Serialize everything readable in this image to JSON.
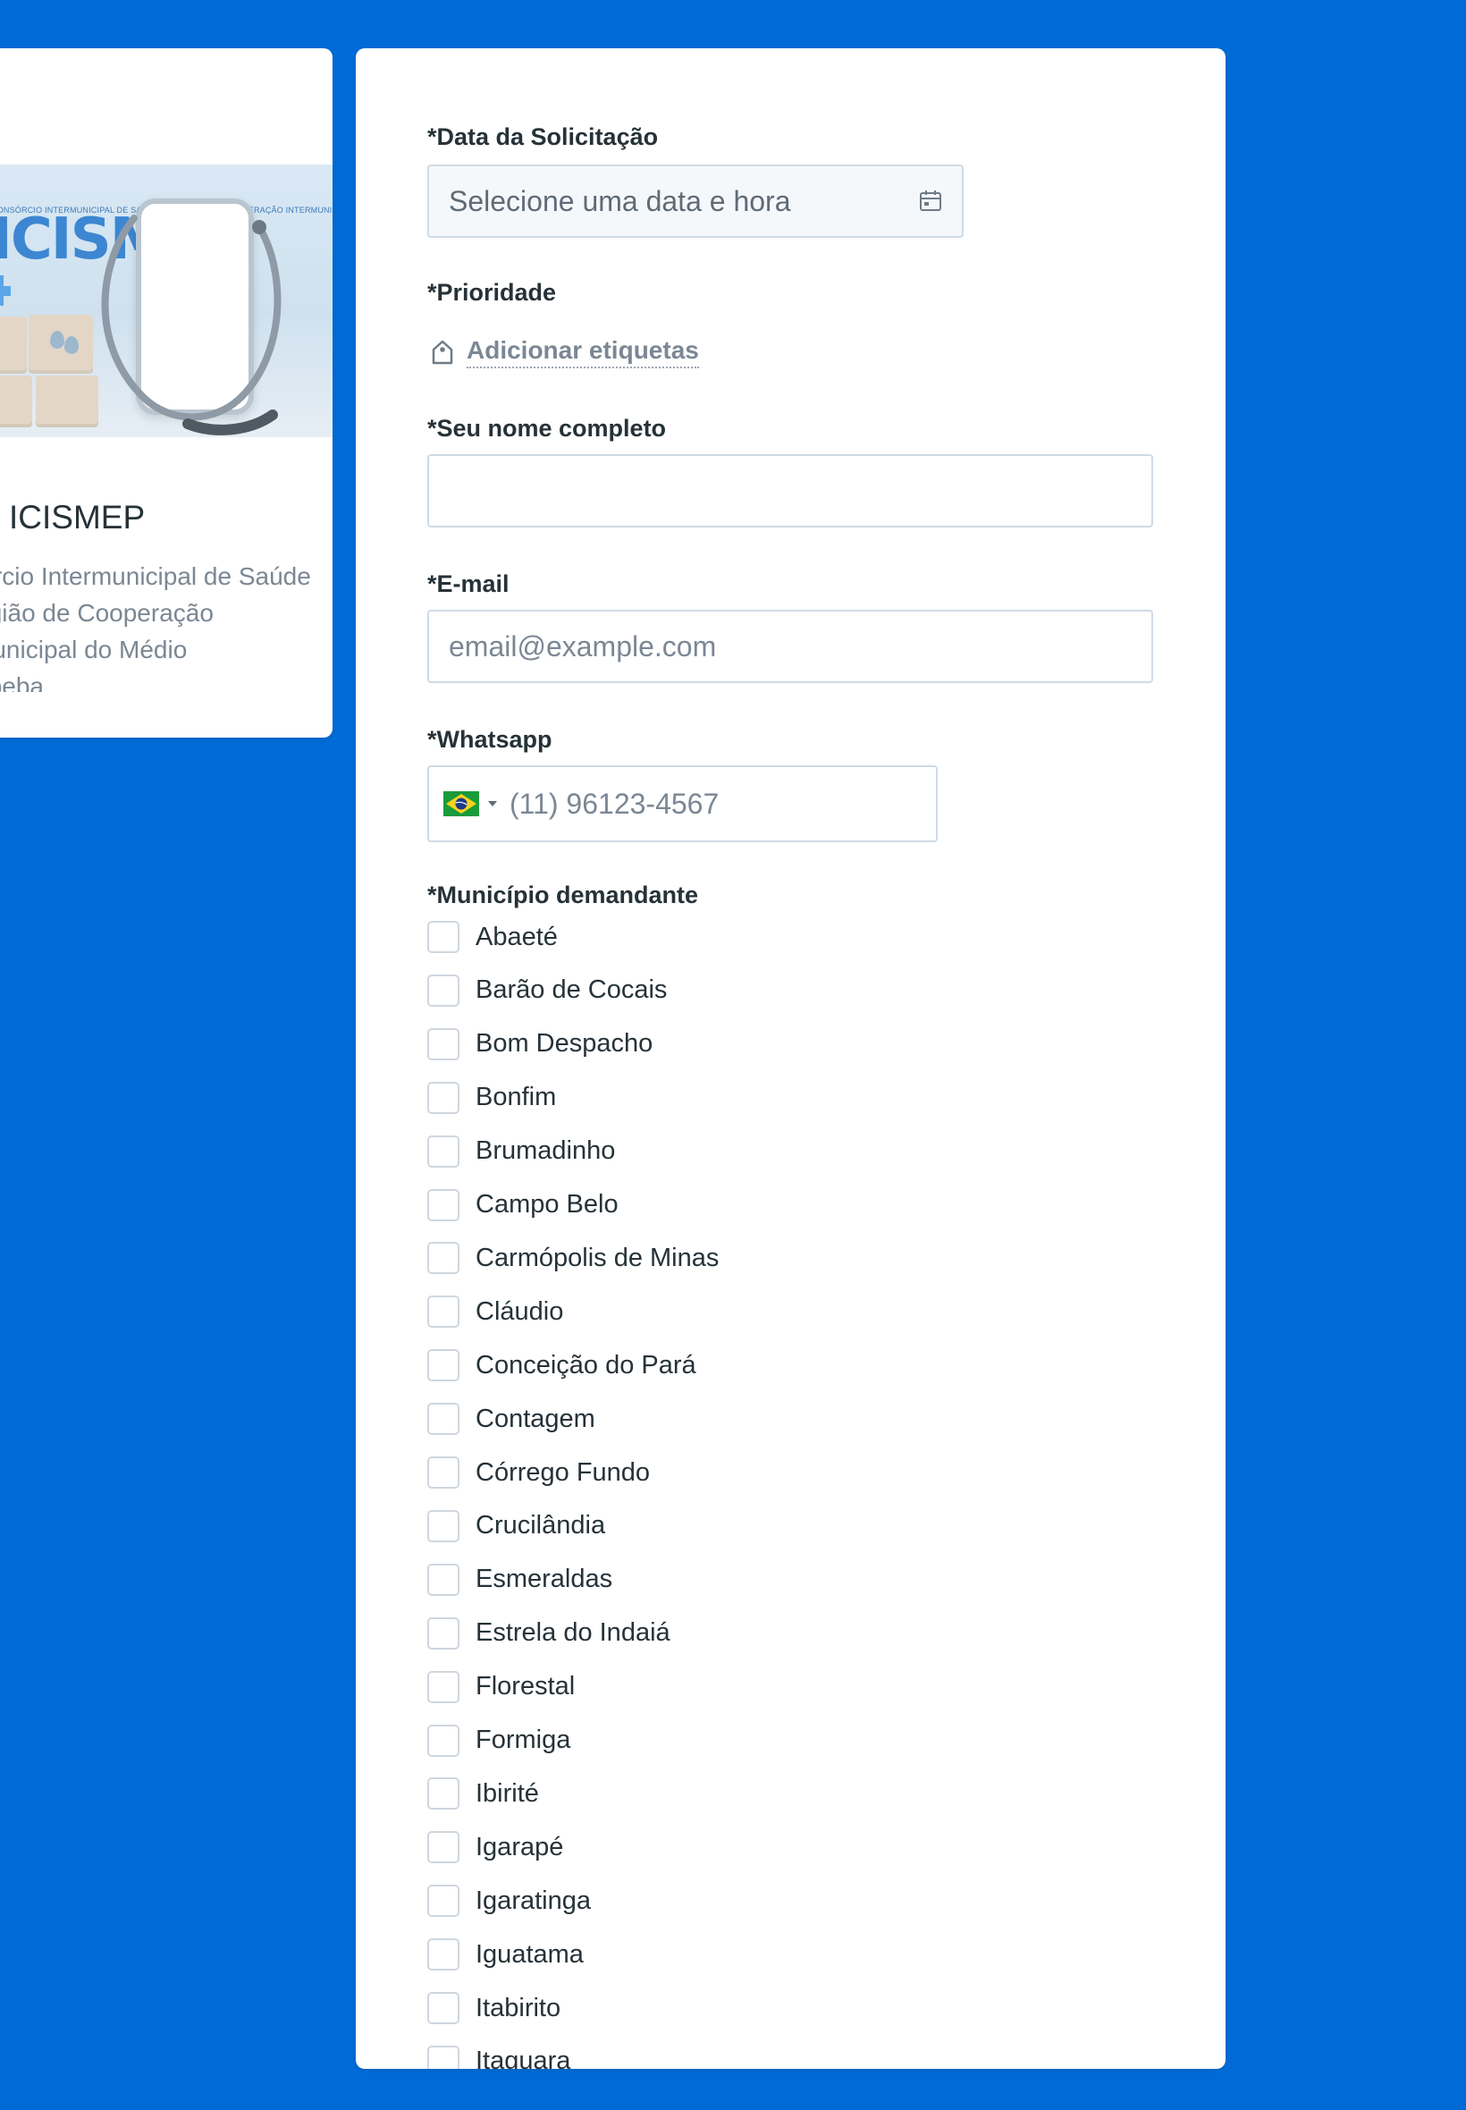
{
  "info_card": {
    "title": "ICISMEP",
    "description": "Consórcio Intermunicipal de Saúde da Região de Cooperação Intermunicipal do Médio Paraopeba",
    "hero": {
      "logo_text": "ICISMEP",
      "caption": "CONSÓRCIO INTERMUNICIPAL DE SAÚDE DA REGIÃO DE COOPERAÇÃO INTERMUNICIPAL DO MÉDIO PARAOPEBA"
    }
  },
  "form": {
    "date": {
      "label": "*Data da Solicitação",
      "placeholder": "Selecione uma data e hora"
    },
    "priority": {
      "label": "*Prioridade",
      "add_tags_label": "Adicionar etiquetas"
    },
    "name": {
      "label": "*Seu nome completo",
      "value": ""
    },
    "email": {
      "label": "*E-mail",
      "placeholder": "email@example.com"
    },
    "whatsapp": {
      "label": "*Whatsapp",
      "placeholder": "(11) 96123-4567",
      "country": "brazil-flag-icon"
    },
    "municipality": {
      "label": "*Município demandante",
      "options": [
        "Abaeté",
        "Barão de Cocais",
        "Bom Despacho",
        "Bonfim",
        "Brumadinho",
        "Campo Belo",
        "Carmópolis de Minas",
        "Cláudio",
        "Conceição do Pará",
        "Contagem",
        "Córrego Fundo",
        "Crucilândia",
        "Esmeraldas",
        "Estrela do Indaiá",
        "Florestal",
        "Formiga",
        "Ibirité",
        "Igarapé",
        "Igaratinga",
        "Iguatama",
        "Itabirito",
        "Itaguara"
      ]
    }
  },
  "colors": {
    "page_background": "#006bd6",
    "card_background": "#ffffff",
    "text_primary": "#263238",
    "text_muted": "#7b8794",
    "border": "#cfdae6"
  }
}
